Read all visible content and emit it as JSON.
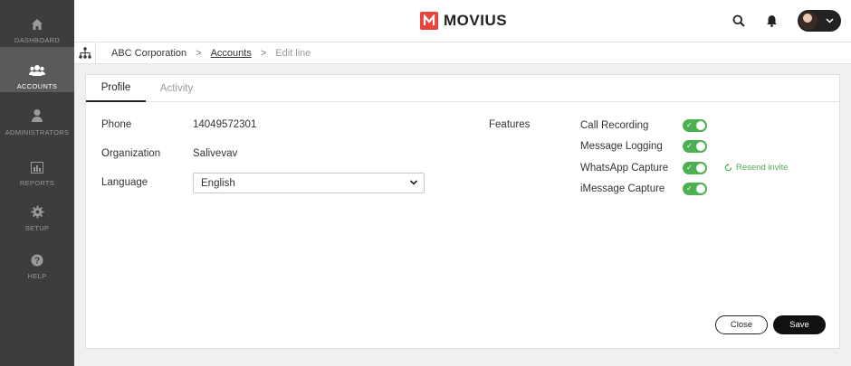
{
  "app": {
    "logo_text": "MOVIUS",
    "brand_color": "#e8443a"
  },
  "sidebar": {
    "items": [
      {
        "label": "DASHBOARD",
        "icon": "home-icon",
        "active": false
      },
      {
        "label": "ACCOUNTS",
        "icon": "users-icon",
        "active": true
      },
      {
        "label": "ADMINISTRATORS",
        "icon": "admin-icon",
        "active": false
      },
      {
        "label": "REPORTS",
        "icon": "reports-icon",
        "active": false
      },
      {
        "label": "SETUP",
        "icon": "gear-icon",
        "active": false
      },
      {
        "label": "HELP",
        "icon": "help-icon",
        "active": false
      }
    ]
  },
  "header": {
    "icons": [
      "search-icon",
      "bell-icon",
      "avatar",
      "chevron-down-icon"
    ]
  },
  "breadcrumb": {
    "root_icon": "org-tree-icon",
    "items": [
      {
        "label": "ABC Corporation"
      },
      {
        "label": "Accounts"
      },
      {
        "label": "Edit line"
      }
    ],
    "separator": ">"
  },
  "tabs": [
    {
      "label": "Profile",
      "active": true
    },
    {
      "label": "Activity",
      "active": false
    }
  ],
  "profile": {
    "phone_label": "Phone",
    "phone_value": "14049572301",
    "org_label": "Organization",
    "org_value": "Salivevav",
    "language_label": "Language",
    "language_value": "English"
  },
  "features": {
    "label": "Features",
    "items": [
      {
        "label": "Call Recording",
        "enabled": true
      },
      {
        "label": "Message Logging",
        "enabled": true
      },
      {
        "label": "WhatsApp Capture",
        "enabled": true,
        "action": "Resend invite"
      },
      {
        "label": "iMessage Capture",
        "enabled": true
      }
    ],
    "toggle_color": "#4caf50"
  },
  "actions": {
    "close_label": "Close",
    "save_label": "Save"
  }
}
